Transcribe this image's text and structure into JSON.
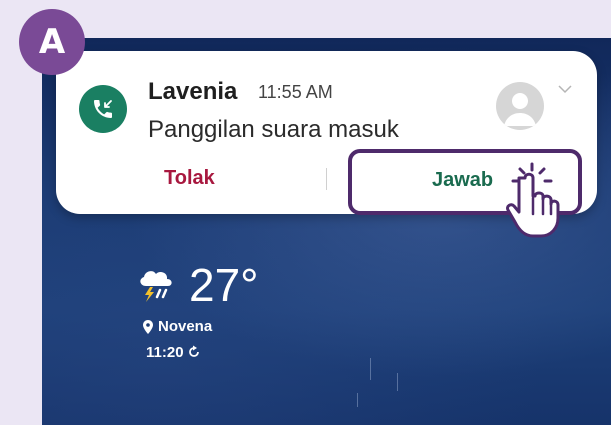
{
  "badge": {
    "label": "A"
  },
  "notification": {
    "caller": "Lavenia",
    "time": "11:55 AM",
    "message": "Panggilan suara masuk",
    "reject_label": "Tolak",
    "answer_label": "Jawab"
  },
  "weather": {
    "temperature": "27°",
    "location": "Novena",
    "updated_time": "11:20"
  },
  "icons": {
    "app": "incoming-call-icon",
    "avatar": "contact-avatar-icon",
    "expand": "chevron-down-icon",
    "pointer": "tap-hand-icon",
    "weather": "thunder-rain-icon",
    "location": "location-pin-icon",
    "refresh": "refresh-icon"
  },
  "colors": {
    "badge": "#7a4a96",
    "call_app": "#1a7f62",
    "reject": "#a8183f",
    "answer": "#1a6b4f",
    "highlight": "#4e2a6b"
  }
}
